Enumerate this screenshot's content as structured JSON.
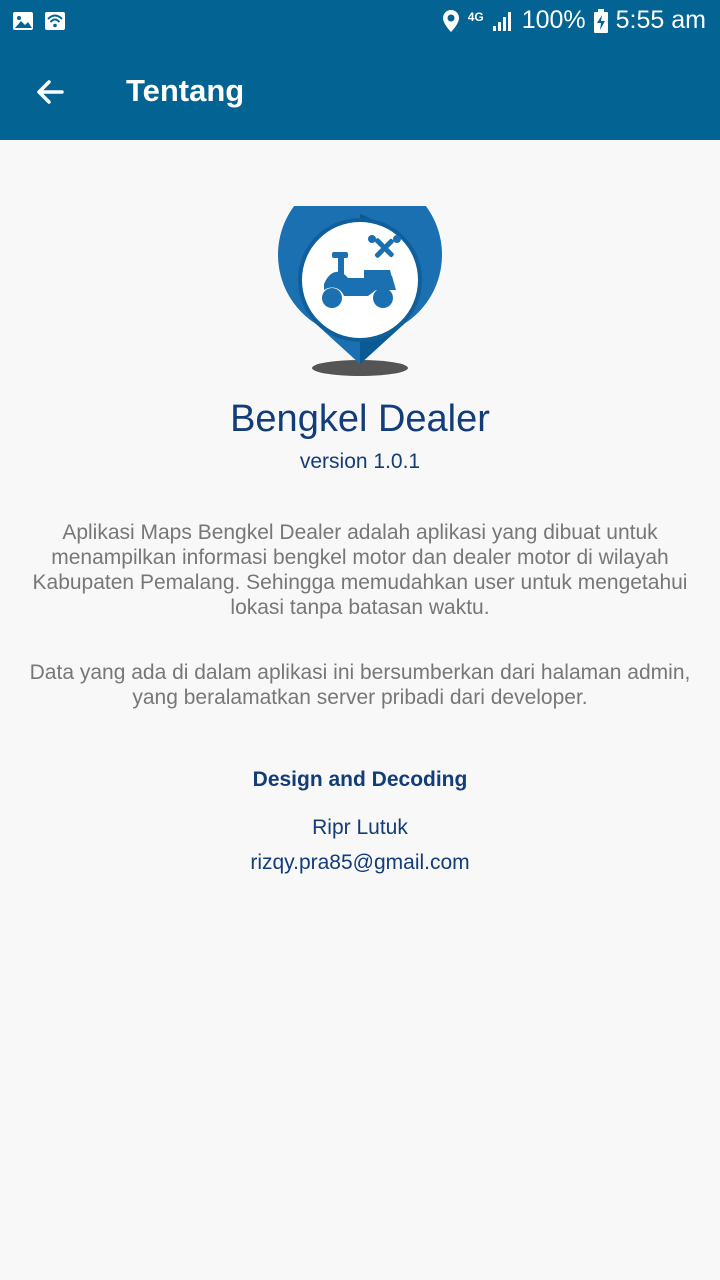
{
  "status_bar": {
    "network_label": "4G",
    "battery": "100%",
    "time": "5:55 am",
    "icons": [
      "image-icon",
      "wifi-icon",
      "location-icon",
      "signal-icon",
      "battery-charging-icon"
    ]
  },
  "app_bar": {
    "title": "Tentang",
    "back_icon": "arrow-back-icon"
  },
  "about": {
    "app_name": "Bengkel Dealer",
    "version": "version 1.0.1",
    "description_1": "Aplikasi Maps Bengkel Dealer adalah aplikasi yang dibuat untuk menampilkan informasi bengkel motor dan dealer motor di wilayah Kabupaten Pemalang. Sehingga memudahkan user untuk mengetahui lokasi tanpa batasan waktu.",
    "description_2": "Data yang ada di dalam aplikasi ini bersumberkan dari halaman admin, yang beralamatkan server pribadi dari developer.",
    "credit_heading": "Design and Decoding",
    "author": "Ripr Lutuk",
    "email": "rizqy.pra85@gmail.com"
  },
  "colors": {
    "primary": "#036392",
    "text_primary": "#123c7a",
    "text_secondary": "#777777",
    "background": "#f8f8f8"
  }
}
